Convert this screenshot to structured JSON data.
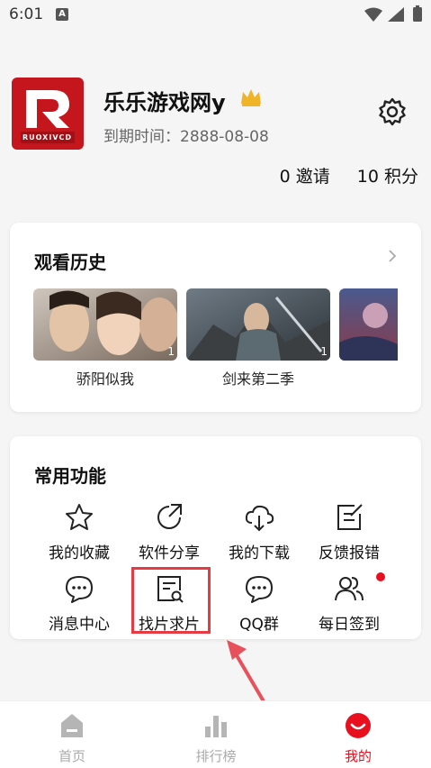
{
  "status_bar": {
    "time": "6:01",
    "notif_icon": "A",
    "icons": [
      "wifi-icon",
      "signal-icon",
      "battery-icon"
    ]
  },
  "profile": {
    "logo_text": "RUOXIVCD",
    "name": "乐乐游戏网y",
    "expiry": "到期时间：2888-08-08",
    "invites": "0 邀请",
    "points": "10 积分"
  },
  "history": {
    "title": "观看历史",
    "items": [
      {
        "title": "骄阳似我",
        "badge": "1"
      },
      {
        "title": "剑来第二季",
        "badge": "1"
      },
      {
        "title": "",
        "badge": ""
      }
    ]
  },
  "functions": {
    "title": "常用功能",
    "items": [
      {
        "label": "我的收藏",
        "icon": "star-icon"
      },
      {
        "label": "软件分享",
        "icon": "share-icon"
      },
      {
        "label": "我的下载",
        "icon": "cloud-download-icon"
      },
      {
        "label": "反馈报错",
        "icon": "feedback-edit-icon"
      },
      {
        "label": "消息中心",
        "icon": "message-icon"
      },
      {
        "label": "找片求片",
        "icon": "search-document-icon"
      },
      {
        "label": "QQ群",
        "icon": "chat-group-icon"
      },
      {
        "label": "每日签到",
        "icon": "users-icon"
      }
    ]
  },
  "nav": {
    "items": [
      {
        "label": "首页",
        "icon": "home-icon",
        "active": false
      },
      {
        "label": "排行榜",
        "icon": "rank-icon",
        "active": false
      },
      {
        "label": "我的",
        "icon": "smile-icon",
        "active": true
      }
    ]
  },
  "colors": {
    "accent": "#e8101e",
    "highlight": "#e83a43",
    "inactive": "#aaaaaa"
  }
}
